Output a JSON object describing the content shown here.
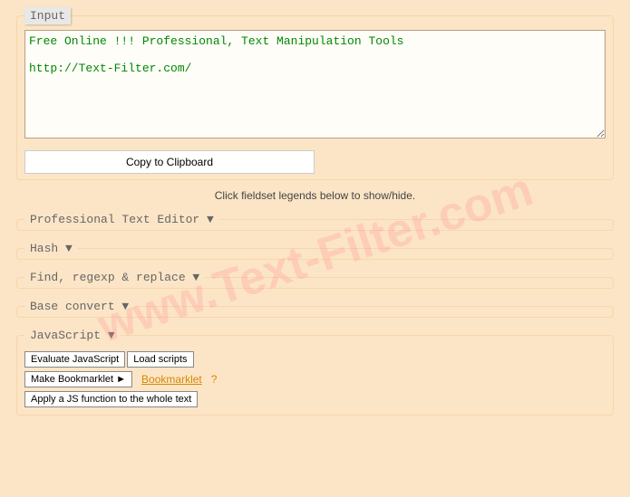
{
  "input": {
    "legend": "Input",
    "textarea_value": "Free Online !!! Professional, Text Manipulation Tools\n\nhttp://Text-Filter.com/",
    "copy_label": "Copy to Clipboard"
  },
  "hint": "Click fieldset legends below to show/hide.",
  "sections": {
    "editor": "Professional Text Editor ▼",
    "hash": "Hash ▼",
    "find": "Find, regexp & replace ▼",
    "base": "Base convert ▼",
    "js": "JavaScript ▼"
  },
  "js_panel": {
    "eval_btn": "Evaluate JavaScript",
    "load_btn": "Load scripts",
    "bookmarklet_btn": "Make Bookmarklet ►",
    "bookmarklet_link": "Bookmarklet",
    "help": "?",
    "apply_btn": "Apply a JS function to the whole text"
  },
  "watermark": "www.Text-Filter.com"
}
